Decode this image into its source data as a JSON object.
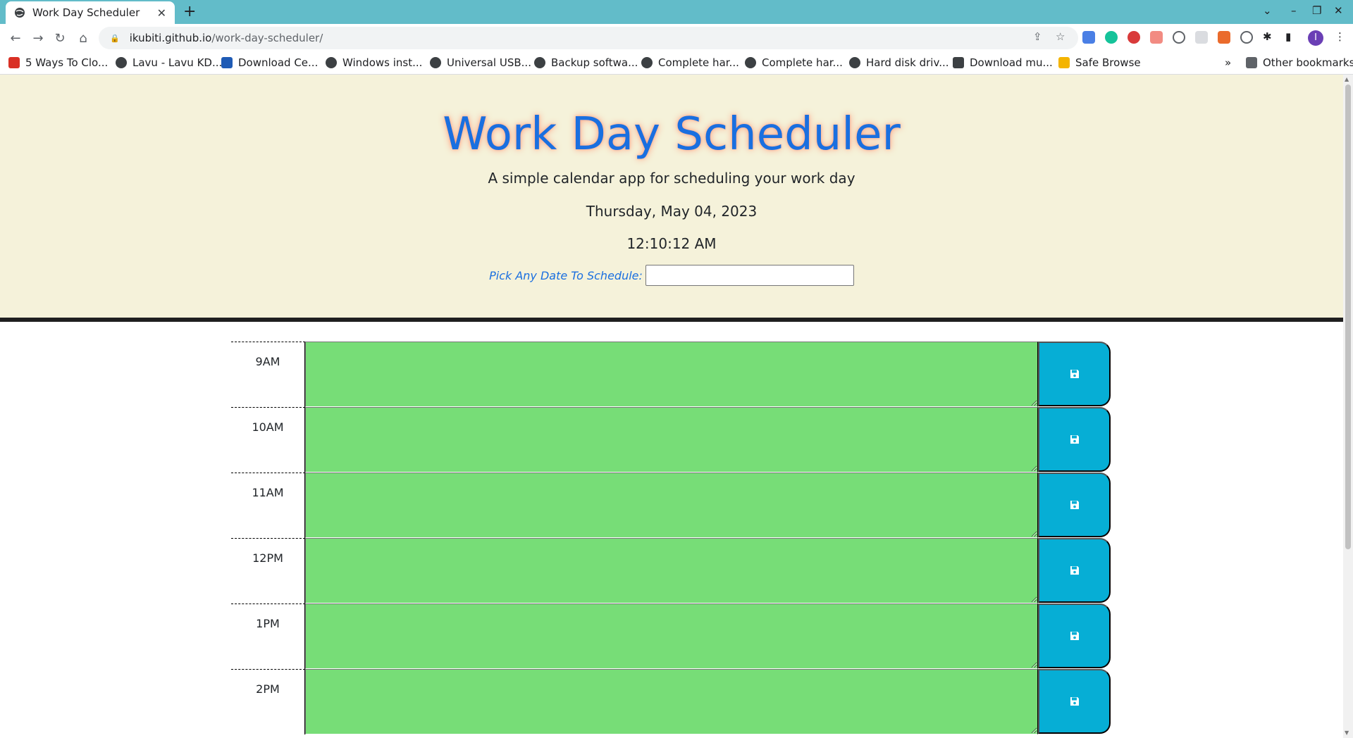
{
  "browser": {
    "tab_title": "Work Day Scheduler",
    "url_host": "ikubiti.github.io",
    "url_path": "/work-day-scheduler/",
    "profile_initial": "I"
  },
  "bookmarks": [
    {
      "label": "5 Ways To Clo...",
      "icon": "bookmark-favicon-red"
    },
    {
      "label": "Lavu - Lavu KD...",
      "icon": "globe-icon"
    },
    {
      "label": "Download Ce...",
      "icon": "bookmark-favicon-blue"
    },
    {
      "label": "Windows inst...",
      "icon": "globe-icon"
    },
    {
      "label": "Universal USB...",
      "icon": "globe-icon"
    },
    {
      "label": "Backup softwa...",
      "icon": "globe-icon"
    },
    {
      "label": "Complete har...",
      "icon": "globe-icon"
    },
    {
      "label": "Complete har...",
      "icon": "globe-icon"
    },
    {
      "label": "Hard disk driv...",
      "icon": "globe-icon"
    },
    {
      "label": "Download mu...",
      "icon": "bookmark-favicon-dark"
    },
    {
      "label": "Safe Browse",
      "icon": "bookmark-favicon-lock"
    }
  ],
  "other_bookmarks": "Other bookmarks",
  "header": {
    "title": "Work Day Scheduler",
    "lead": "A simple calendar app for scheduling your work day",
    "current_date": "Thursday, May 04, 2023",
    "current_time": "12:10:12 AM",
    "picker_label": "Pick Any Date To Schedule:",
    "picker_value": ""
  },
  "timeblocks": [
    {
      "hour": "9AM",
      "text": "",
      "state": "future"
    },
    {
      "hour": "10AM",
      "text": "",
      "state": "future"
    },
    {
      "hour": "11AM",
      "text": "",
      "state": "future"
    },
    {
      "hour": "12PM",
      "text": "",
      "state": "future"
    },
    {
      "hour": "1PM",
      "text": "",
      "state": "future"
    },
    {
      "hour": "2PM",
      "text": "",
      "state": "future"
    }
  ],
  "colors": {
    "future": "#77dd77",
    "save_button": "#06aed5",
    "title": "#1a6fe0",
    "jumbotron": "#f5f2da"
  }
}
